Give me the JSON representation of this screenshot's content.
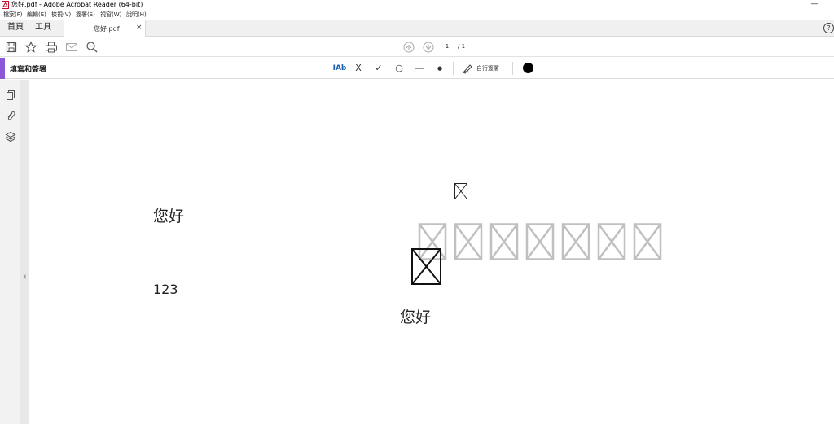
{
  "window": {
    "title": "您好.pdf - Adobe Acrobat Reader (64-bit)",
    "app_icon": "acrobat-icon",
    "minimize_glyph": "—",
    "close_glyph": "✕"
  },
  "menu": {
    "items": [
      "檔案(F)",
      "編輯(E)",
      "檢視(V)",
      "簽署(S)",
      "視窗(W)",
      "說明(H)"
    ]
  },
  "tabs": {
    "home": "首頁",
    "tools": "工具",
    "document": "您好.pdf",
    "close_glyph": "×",
    "help_glyph": "?"
  },
  "toolbar": {
    "icons": [
      "save-icon",
      "bookmark-star-icon",
      "print-icon",
      "email-icon",
      "zoom-out-icon",
      "page-up-icon",
      "page-down-icon"
    ],
    "page_current": "1",
    "page_total": "/ 1"
  },
  "fill_sign": {
    "title": "填寫和簽署",
    "text_tool": "IAb",
    "cross_tool": "X",
    "check_tool": "✓",
    "ellipse_tool": "○",
    "line_tool": "—",
    "dot_tool": "●",
    "sign_label": "自行簽署",
    "color": "#000000"
  },
  "left_nav": {
    "icons": [
      "pages-icon",
      "attachment-icon",
      "layers-icon"
    ]
  },
  "document": {
    "text1": "您好",
    "text2": "123",
    "text3": "您好",
    "glyph_box_color": "#c0c0c0",
    "glyph_box_count": 7
  }
}
